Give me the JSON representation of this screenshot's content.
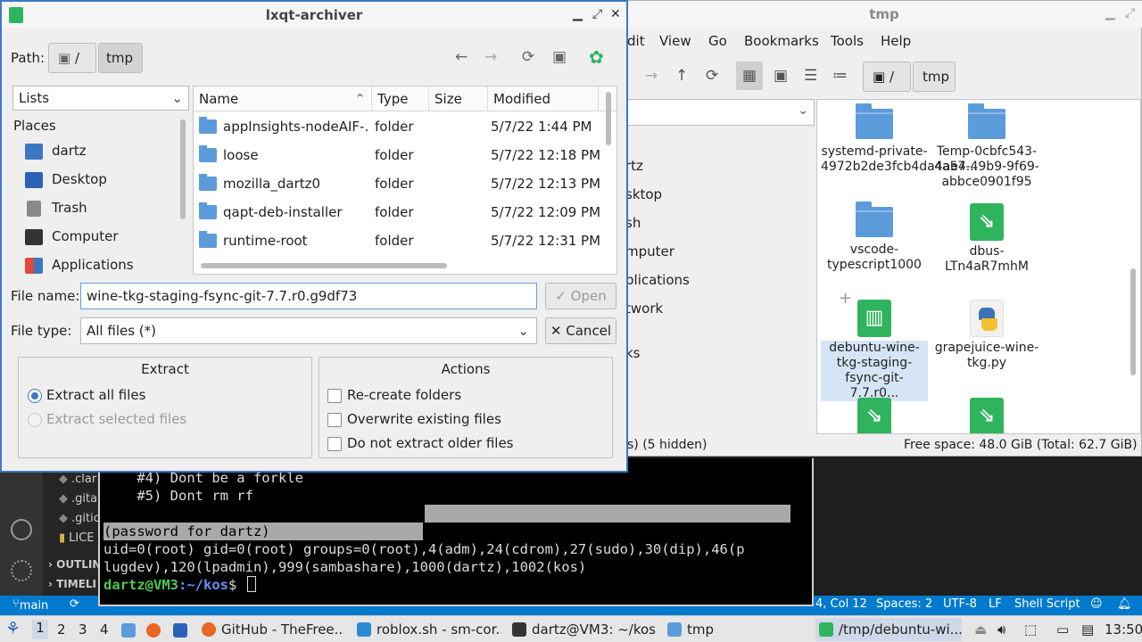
{
  "dialog": {
    "title": "lxqt-archiver",
    "path_label": "Path:",
    "path_root": "/",
    "path_current": "tmp",
    "places_combo": "Lists",
    "places_header": "Places",
    "places": [
      {
        "label": "dartz",
        "icon": "home-icon"
      },
      {
        "label": "Desktop",
        "icon": "desktop-icon"
      },
      {
        "label": "Trash",
        "icon": "trash-icon"
      },
      {
        "label": "Computer",
        "icon": "computer-icon"
      },
      {
        "label": "Applications",
        "icon": "applications-icon"
      }
    ],
    "columns": [
      "Name",
      "Type",
      "Size",
      "Modified"
    ],
    "files": [
      {
        "name": "appInsights-nodeAIF-...",
        "type": "folder",
        "size": "",
        "modified": "5/7/22 1:44 PM"
      },
      {
        "name": "loose",
        "type": "folder",
        "size": "",
        "modified": "5/7/22 12:18 PM"
      },
      {
        "name": "mozilla_dartz0",
        "type": "folder",
        "size": "",
        "modified": "5/7/22 12:13 PM"
      },
      {
        "name": "qapt-deb-installer",
        "type": "folder",
        "size": "",
        "modified": "5/7/22 12:09 PM"
      },
      {
        "name": "runtime-root",
        "type": "folder",
        "size": "",
        "modified": "5/7/22 12:31 PM"
      }
    ],
    "file_name_label": "File name:",
    "file_name_value": "wine-tkg-staging-fsync-git-7.7.r0.g9df73",
    "open_button": "Open",
    "file_type_label": "File type:",
    "file_type_value": "All files (*)",
    "cancel_button": "Cancel",
    "extract_group": "Extract",
    "extract_all": "Extract all files",
    "extract_selected": "Extract selected files",
    "actions_group": "Actions",
    "recreate_folders": "Re-create folders",
    "overwrite_files": "Overwrite existing files",
    "no_extract_older": "Do not extract older files"
  },
  "filemanager": {
    "title": "tmp",
    "menu": [
      "dit",
      "View",
      "Go",
      "Bookmarks",
      "Tools",
      "Help"
    ],
    "path_root": "/",
    "path_current": "tmp",
    "side_partial": [
      "rtz",
      "sktop",
      "sh",
      "mputer",
      "plications",
      "twork",
      "ks"
    ],
    "items": [
      {
        "label": "systemd-private-4972b2de3fcb4da4ae4...",
        "icon": "folder-icon"
      },
      {
        "label": "Temp-0cbfc543-4a57-49b9-9f69-abbce0901f95",
        "icon": "folder-icon"
      },
      {
        "label": "vscode-typescript1000",
        "icon": "folder-icon"
      },
      {
        "label": "dbus-LTn4aR7mhM",
        "icon": "socket-icon"
      },
      {
        "label": "debuntu-wine-tkg-staging-fsync-git-7.7.r0...",
        "icon": "archive-icon"
      },
      {
        "label": "grapejuice-wine-tkg.py",
        "icon": "python-file-icon"
      }
    ],
    "status_left": "s) (5 hidden)",
    "status_right": "Free space: 48.0 GiB (Total: 62.7 GiB)"
  },
  "terminal": {
    "line1": "    #4) Dont be a forkle",
    "line2": "    #5) Dont rm rf",
    "line3": "(password for dartz)",
    "line4": "uid=0(root) gid=0(root) groups=0(root),4(adm),24(cdrom),27(sudo),30(dip),46(p",
    "line5": "lugdev),120(lpadmin),999(sambashare),1000(dartz),1002(kos)",
    "prompt_user": "dartz@VM3",
    "prompt_path": ":~/kos",
    "prompt_sym": "$ "
  },
  "vscode": {
    "explorer_files": [
      ".clar",
      ".gita",
      ".gitic",
      "LICE"
    ],
    "outline": "OUTLIN",
    "timeline": "TIMELI",
    "status_branch": "main",
    "status_pos": "4, Col 12",
    "status_spaces": "Spaces: 2",
    "status_encoding": "UTF-8",
    "status_eol": "LF",
    "status_lang": "Shell Script"
  },
  "taskbar": {
    "workspaces": [
      "1",
      "2",
      "3",
      "4"
    ],
    "tasks": [
      {
        "label": "GitHub - TheFree...",
        "icon": "firefox-icon"
      },
      {
        "label": "roblox.sh - sm-cor...",
        "icon": "vscode-icon"
      },
      {
        "label": "dartz@VM3: ~/kos",
        "icon": "terminal-icon"
      },
      {
        "label": "tmp",
        "icon": "folder-icon"
      },
      {
        "label": "/tmp/debuntu-wi...",
        "icon": "archiver-icon"
      }
    ],
    "clock": "13:50"
  }
}
